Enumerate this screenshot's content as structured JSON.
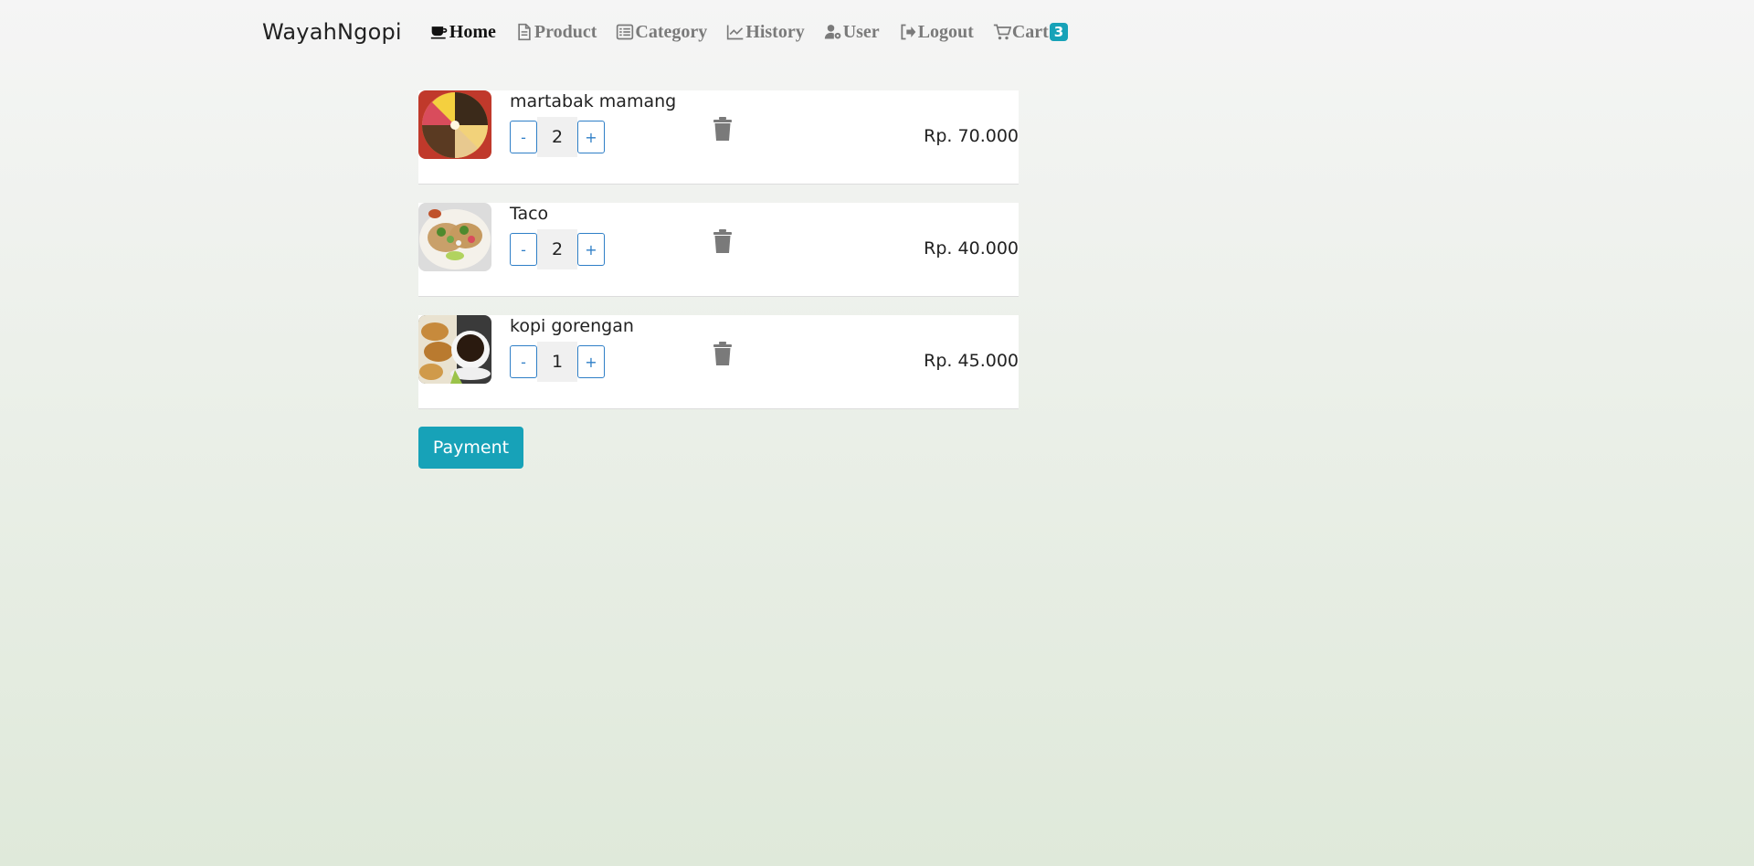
{
  "brand": "WayahNgopi",
  "nav": {
    "home": "Home",
    "product": "Product",
    "category": "Category",
    "history": "History",
    "user": "User",
    "logout": "Logout",
    "cart": "Cart",
    "cart_count": "3"
  },
  "icons": {
    "home": "coffee-cup-icon",
    "product": "document-icon",
    "category": "list-icon",
    "history": "line-chart-icon",
    "user": "user-gear-icon",
    "logout": "logout-icon",
    "cart": "cart-icon",
    "delete": "trash-icon"
  },
  "cart": {
    "items": [
      {
        "name": "martabak mamang",
        "qty": "2",
        "minus": "-",
        "plus": "+",
        "price": "Rp. 70.000",
        "image": "martabak-image"
      },
      {
        "name": "Taco",
        "qty": "2",
        "minus": "-",
        "plus": "+",
        "price": "Rp. 40.000",
        "image": "taco-image"
      },
      {
        "name": "kopi gorengan",
        "qty": "1",
        "minus": "-",
        "plus": "+",
        "price": "Rp. 45.000",
        "image": "coffee-fritter-image"
      }
    ]
  },
  "payment_label": "Payment",
  "colors": {
    "accent": "#17a2b8",
    "qty_button": "#2f7fc7",
    "nav_muted": "#7a7a7a",
    "trash": "#7a7a7a"
  }
}
